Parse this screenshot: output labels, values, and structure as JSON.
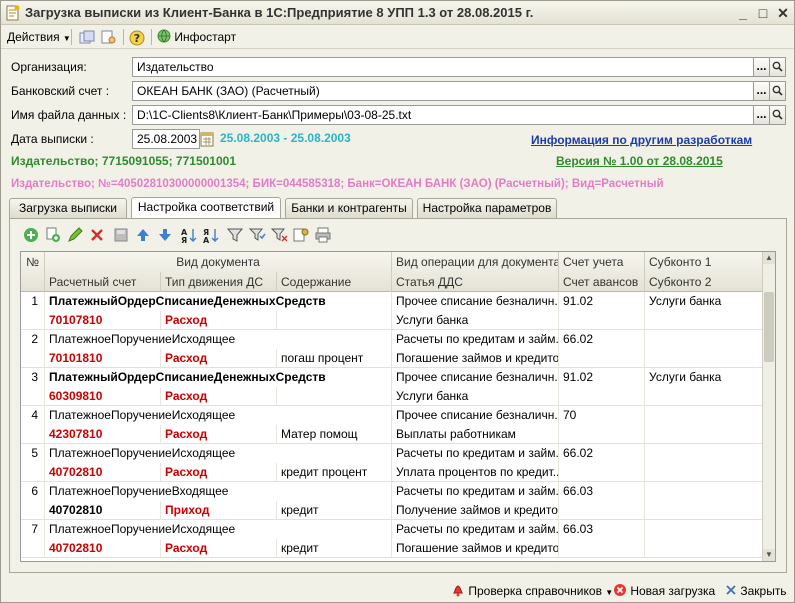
{
  "window": {
    "title": "Загрузка выписки из Клиент-Банка в 1С:Предприятие 8 УПП 1.3 от 28.08.2015 г.",
    "controls": [
      "minimize",
      "maximize",
      "close"
    ]
  },
  "toolbar": {
    "actions_label": "Действия",
    "infostart_label": "Инфостарт"
  },
  "form": {
    "org_label": "Организация:",
    "org_value": "Издательство",
    "bank_label": "Банковский счет :",
    "bank_value": "ОКЕАН БАНК (ЗАО) (Расчетный)",
    "file_label": "Имя файла данных :",
    "file_value": "D:\\1C-Clients8\\Клиент-Банк\\Примеры\\03-08-25.txt",
    "date_label": "Дата выписки :",
    "date_value": "25.08.2003",
    "period_text": "25.08.2003 - 25.08.2003",
    "info_link": "Информация по другим разработкам",
    "org_info": "Издательство; 7715091055; 771501001",
    "version": "Версия № 1.00 от 28.08.2015",
    "account_info": "Издательство; №=40502810300000001354; БИК=044585318; Банк=ОКЕАН БАНК (ЗАО) (Расчетный); Вид=Расчетный"
  },
  "tabs": [
    {
      "label": "Загрузка выписки",
      "active": false
    },
    {
      "label": "Настройка соответствий",
      "active": true
    },
    {
      "label": "Банки и контрагенты",
      "active": false
    },
    {
      "label": "Настройка параметров",
      "active": false
    }
  ],
  "icon_bar": [
    "add-icon",
    "copy-icon",
    "edit-icon",
    "delete-icon",
    "save-icon",
    "move-up-icon",
    "move-down-icon",
    "sort-asc-icon",
    "sort-desc-icon",
    "filter-icon",
    "filter-set-icon",
    "filter-clear-icon",
    "settings-icon",
    "print-icon"
  ],
  "grid": {
    "headers_top": {
      "num": "№",
      "doc_type": "Вид документа",
      "op_type": "Вид операции для документа",
      "account": "Счет учета",
      "subconto1": "Субконто 1"
    },
    "headers_bottom": {
      "settlement": "Расчетный счет",
      "movement": "Тип движения ДС",
      "content": "Содержание",
      "dds": "Статья ДДС",
      "advance": "Счет авансов",
      "subconto2": "Субконто 2"
    },
    "rows": [
      {
        "num": "1",
        "doc": "ПлатежныйОрдерСписаниеДенежныхСредств",
        "doc_bold": true,
        "op": "Прочее списание безналичн...",
        "acc": "91.02",
        "sub1": "Услуги банка",
        "settle": "70107810",
        "move": "Расход",
        "content": "",
        "dds": "Услуги банка",
        "adv": "",
        "sub2": ""
      },
      {
        "num": "2",
        "doc": "ПлатежноеПоручениеИсходящее",
        "doc_bold": false,
        "op": "Расчеты по кредитам и займ...",
        "acc": "66.02",
        "sub1": "",
        "settle": "70101810",
        "move": "Расход",
        "content": "погаш процент",
        "dds": "Погашение займов и кредитов",
        "adv": "",
        "sub2": ""
      },
      {
        "num": "3",
        "doc": "ПлатежныйОрдерСписаниеДенежныхСредств",
        "doc_bold": true,
        "op": "Прочее списание безналичн...",
        "acc": "91.02",
        "sub1": "Услуги банка",
        "settle": "60309810",
        "move": "Расход",
        "content": "",
        "dds": "Услуги банка",
        "adv": "",
        "sub2": ""
      },
      {
        "num": "4",
        "doc": "ПлатежноеПоручениеИсходящее",
        "doc_bold": false,
        "op": "Прочее списание безналичн...",
        "acc": "70",
        "sub1": "",
        "settle": "42307810",
        "move": "Расход",
        "content": "Матер помощ",
        "dds": "Выплаты работникам",
        "adv": "",
        "sub2": ""
      },
      {
        "num": "5",
        "doc": "ПлатежноеПоручениеИсходящее",
        "doc_bold": false,
        "op": "Расчеты по кредитам и займ...",
        "acc": "66.02",
        "sub1": "",
        "settle": "40702810",
        "move": "Расход",
        "content": "кредит процент",
        "dds": "Уплата процентов по кредит...",
        "adv": "",
        "sub2": ""
      },
      {
        "num": "6",
        "doc": "ПлатежноеПоручениеВходящее",
        "doc_bold": false,
        "op": "Расчеты по кредитам и займ...",
        "acc": "66.03",
        "sub1": "",
        "settle": "40702810",
        "move": "Приход",
        "content": "кредит",
        "dds": "Получение займов и кредитов",
        "adv": "",
        "sub2": ""
      },
      {
        "num": "7",
        "doc": "ПлатежноеПоручениеИсходящее",
        "doc_bold": false,
        "op": "Расчеты по кредитам и займ...",
        "acc": "66.03",
        "sub1": "",
        "settle": "40702810",
        "move": "Расход",
        "content": "кредит",
        "dds": "Погашение займов и кредитов",
        "adv": "",
        "sub2": ""
      }
    ]
  },
  "bottom": {
    "check_label": "Проверка справочников",
    "new_load_label": "Новая загрузка",
    "close_label": "Закрыть"
  }
}
